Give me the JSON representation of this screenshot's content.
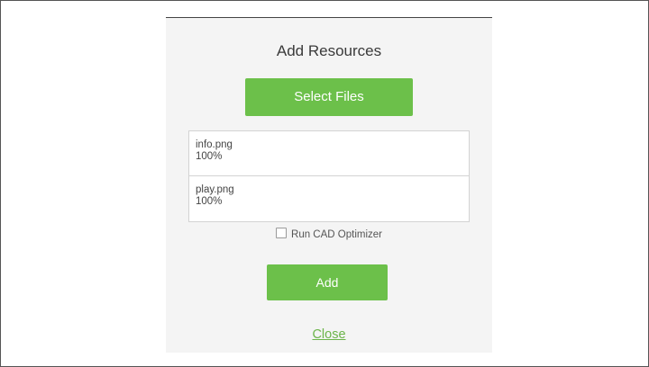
{
  "dialog": {
    "title": "Add Resources",
    "select_files_label": "Select Files",
    "files": [
      {
        "name": "info.png",
        "progress": "100%"
      },
      {
        "name": "play.png",
        "progress": "100%"
      }
    ],
    "optimizer_label": "Run CAD Optimizer",
    "optimizer_checked": false,
    "add_label": "Add",
    "close_label": "Close"
  },
  "colors": {
    "accent": "#6cc04a",
    "dialog_bg": "#f4f4f4",
    "link": "#6cb44a"
  }
}
